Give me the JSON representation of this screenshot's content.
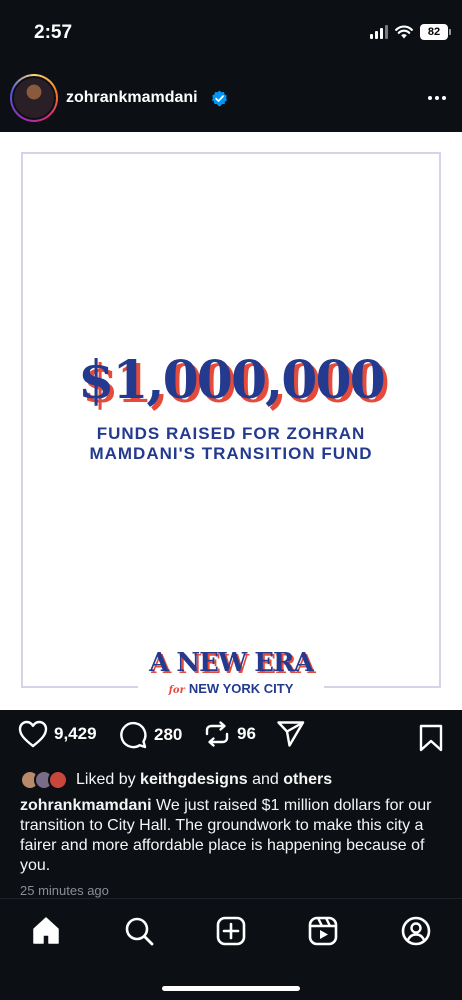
{
  "status_bar": {
    "time": "2:57",
    "battery": "82"
  },
  "post": {
    "username": "zohrankmamdani",
    "verified": true,
    "image": {
      "amount": "$1,000,000",
      "funds_line_1": "FUNDS RAISED FOR ZOHRAN",
      "funds_line_2": "MAMDANI'S TRANSITION FUND",
      "logo_title": "A NEW ERA",
      "logo_for": "for",
      "logo_city": "NEW YORK CITY"
    },
    "actions": {
      "likes": "9,429",
      "comments": "280",
      "reposts": "96"
    },
    "liked_by": {
      "prefix": "Liked by",
      "user": "keithgdesigns",
      "conj": "and",
      "others": "others"
    },
    "caption_user": "zohrankmamdani",
    "caption_text": "We just raised $1 million dollars for our transition to City Hall. The groundwork to make this city a fairer and more affordable place is happening because of you.",
    "timestamp": "25 minutes ago"
  },
  "colors": {
    "brand_blue": "#243a8e",
    "brand_red": "#e44b3a",
    "verified_blue": "#0095f6"
  },
  "tab_bar": [
    "home-icon",
    "search-icon",
    "create-icon",
    "reels-icon",
    "profile-icon"
  ]
}
